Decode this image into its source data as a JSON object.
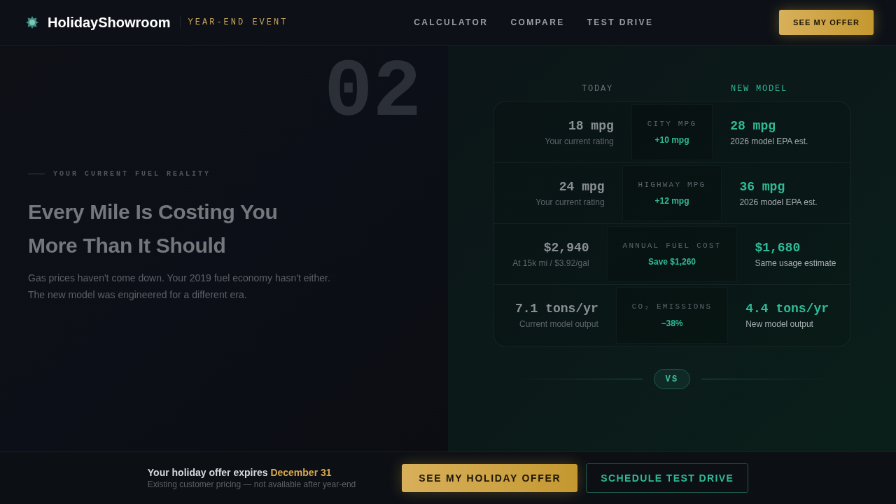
{
  "header": {
    "brand": "HolidayShowroom",
    "event_tag": "YEAR-END EVENT",
    "nav": [
      {
        "label": "CALCULATOR"
      },
      {
        "label": "COMPARE"
      },
      {
        "label": "TEST DRIVE"
      }
    ],
    "cta": "SEE MY OFFER"
  },
  "hero": {
    "section_number": "02",
    "eyebrow": "YOUR CURRENT FUEL REALITY",
    "heading": "Every Mile Is Costing You More Than It Should",
    "description": "Gas prices haven't come down. Your 2019 fuel economy hasn't either. The new model was engineered for a different era."
  },
  "comparison": {
    "columns": {
      "today": "TODAY",
      "new_model": "NEW MODEL"
    },
    "rows": [
      {
        "metric": "CITY MPG",
        "delta": "+10 mpg",
        "today_value": "18 mpg",
        "today_note": "Your current rating",
        "new_value": "28 mpg",
        "new_note": "2026 model EPA est."
      },
      {
        "metric": "HIGHWAY MPG",
        "delta": "+12 mpg",
        "today_value": "24 mpg",
        "today_note": "Your current rating",
        "new_value": "36 mpg",
        "new_note": "2026 model EPA est."
      },
      {
        "metric": "ANNUAL FUEL COST",
        "delta": "Save $1,260",
        "today_value": "$2,940",
        "today_note": "At 15k mi / $3.92/gal",
        "new_value": "$1,680",
        "new_note": "Same usage estimate"
      },
      {
        "metric": "CO₂ EMISSIONS",
        "delta": "−38%",
        "today_value": "7.1 tons/yr",
        "today_note": "Current model output",
        "new_value": "4.4 tons/yr",
        "new_note": "New model output"
      }
    ],
    "divider": "VS"
  },
  "bottom_bar": {
    "offer_text": "Your holiday offer expires",
    "offer_date": "December 31",
    "subtext": "Existing customer pricing — not available after year-end",
    "buttons": [
      {
        "label": "SEE MY HOLIDAY OFFER",
        "kind": "primary"
      },
      {
        "label": "SCHEDULE TEST DRIVE",
        "kind": "outline"
      }
    ]
  }
}
